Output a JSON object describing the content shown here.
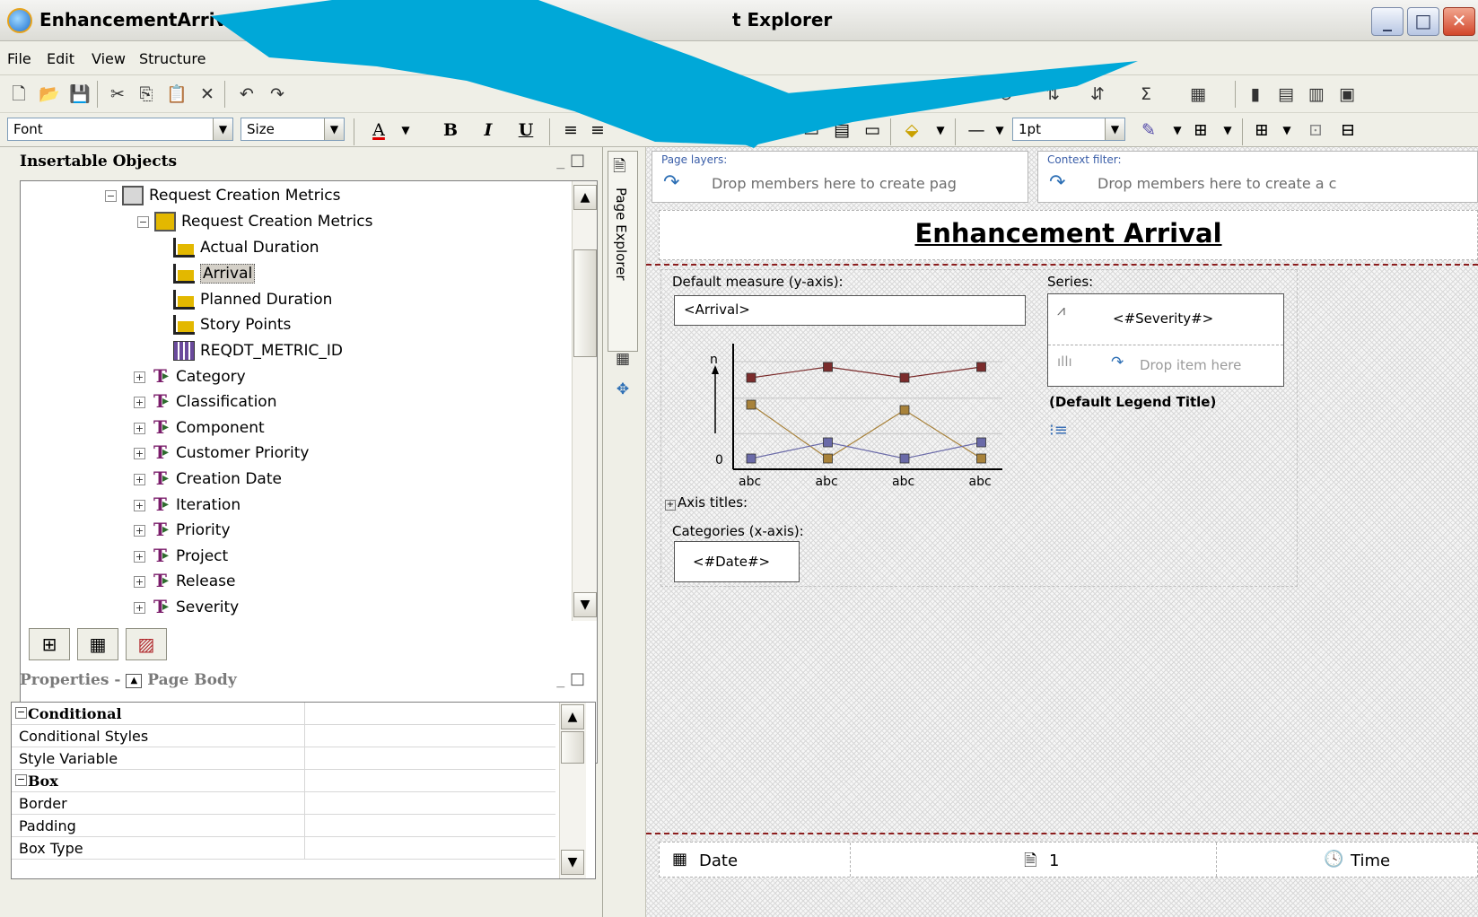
{
  "window": {
    "title": "EnhancementArrivalTendChart - Report Stu",
    "title_tail": "t Explorer",
    "minimize": "_",
    "maximize": "□",
    "close": "✕"
  },
  "menubar": [
    "File",
    "Edit",
    "View",
    "Structure"
  ],
  "toolbar_format": {
    "font": "Font",
    "size": "Size",
    "bold": "B",
    "italic": "I",
    "underline": "U",
    "line_width": "1pt"
  },
  "insertable": {
    "title": "Insertable Objects",
    "tree": [
      {
        "label": "Request Creation Metrics",
        "level": 0,
        "expander": "⊟",
        "icon": "query-icon"
      },
      {
        "label": "Request Creation Metrics",
        "level": 1,
        "expander": "⊟",
        "icon": "table-icon"
      },
      {
        "label": "Actual Duration",
        "level": 2,
        "icon": "measure-icon"
      },
      {
        "label": "Arrival",
        "level": 2,
        "icon": "measure-icon",
        "selected": true
      },
      {
        "label": "Planned Duration",
        "level": 2,
        "icon": "measure-icon"
      },
      {
        "label": "Story Points",
        "level": 2,
        "icon": "measure-icon"
      },
      {
        "label": "REQDT_METRIC_ID",
        "level": 2,
        "icon": "id-icon"
      },
      {
        "label": "Category",
        "level": 1,
        "expander": "⊞",
        "icon": "dimension-icon"
      },
      {
        "label": "Classification",
        "level": 1,
        "expander": "⊞",
        "icon": "dimension-icon"
      },
      {
        "label": "Component",
        "level": 1,
        "expander": "⊞",
        "icon": "dimension-icon"
      },
      {
        "label": "Customer Priority",
        "level": 1,
        "expander": "⊞",
        "icon": "dimension-icon"
      },
      {
        "label": "Creation Date",
        "level": 1,
        "expander": "⊞",
        "icon": "dimension-icon"
      },
      {
        "label": "Iteration",
        "level": 1,
        "expander": "⊞",
        "icon": "dimension-icon"
      },
      {
        "label": "Priority",
        "level": 1,
        "expander": "⊞",
        "icon": "dimension-icon"
      },
      {
        "label": "Project",
        "level": 1,
        "expander": "⊞",
        "icon": "dimension-icon"
      },
      {
        "label": "Release",
        "level": 1,
        "expander": "⊞",
        "icon": "dimension-icon"
      },
      {
        "label": "Severity",
        "level": 1,
        "expander": "⊞",
        "icon": "dimension-icon"
      }
    ]
  },
  "properties": {
    "title": "Properties -",
    "context": "Page Body",
    "rows": [
      {
        "label": "Conditional",
        "group": true
      },
      {
        "label": "Conditional Styles"
      },
      {
        "label": "Style Variable"
      },
      {
        "label": "Box",
        "group": true
      },
      {
        "label": "Border"
      },
      {
        "label": "Padding"
      },
      {
        "label": "Box Type"
      }
    ]
  },
  "page_explorer": {
    "label": "Page Explorer"
  },
  "canvas": {
    "page_layers_label": "Page layers:",
    "page_layers_hint": "Drop members here to create pag",
    "context_filter_label": "Context filter:",
    "context_filter_hint": "Drop members here to create a c",
    "report_title": "Enhancement Arrival",
    "default_measure_label": "Default measure (y-axis):",
    "default_measure_value": "<Arrival>",
    "series_label": "Series:",
    "series_value": "<#Severity#>",
    "series_drop_hint": "Drop item here",
    "legend_title": "(Default Legend Title)",
    "axis_titles": "Axis titles:",
    "categories_label": "Categories (x-axis):",
    "categories_value": "<#Date#>",
    "footer": {
      "date": "Date",
      "page": "1",
      "time": "Time"
    }
  },
  "chart_data": {
    "type": "line",
    "categories": [
      "abc",
      "abc",
      "abc",
      "abc"
    ],
    "y_tick_labels": [
      "n",
      "0"
    ],
    "series": [
      {
        "color": "#7b2c2c",
        "values": [
          0.85,
          0.95,
          0.85,
          0.95
        ]
      },
      {
        "color": "#a8823a",
        "values": [
          0.6,
          0.1,
          0.55,
          0.1
        ]
      },
      {
        "color": "#6a6aa8",
        "values": [
          0.1,
          0.25,
          0.1,
          0.25
        ]
      }
    ]
  },
  "colors": {
    "overlay_arrow": "#00a8d8",
    "chart_grid": "#c8c8c8"
  }
}
